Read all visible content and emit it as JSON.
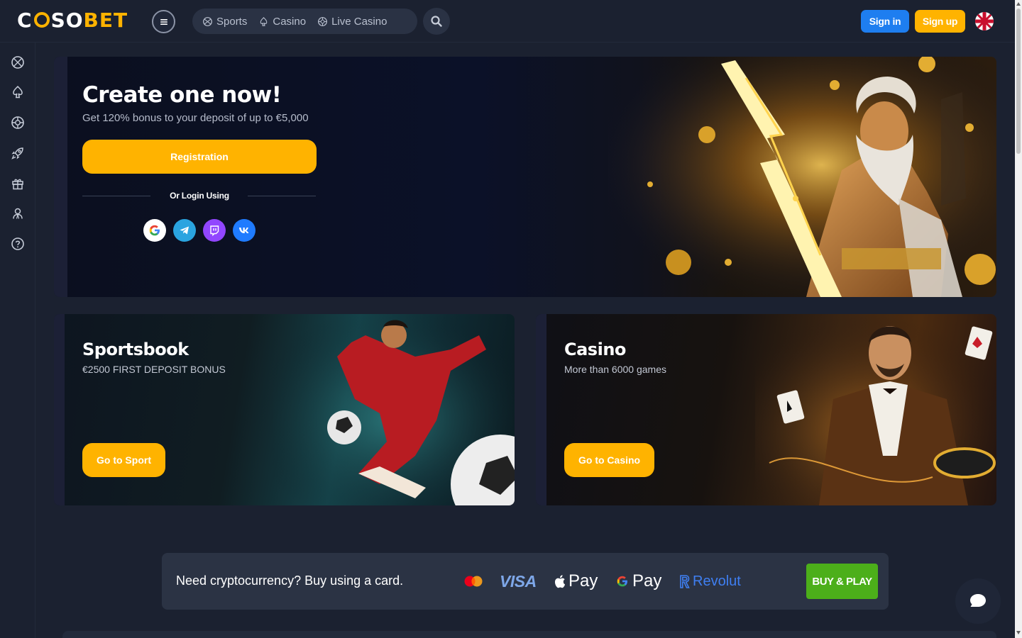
{
  "header": {
    "logo": {
      "part1": "C",
      "part2": "SO",
      "part3": "BET"
    },
    "nav": [
      {
        "label": "Sports",
        "icon": "soccer-ball-icon"
      },
      {
        "label": "Casino",
        "icon": "spade-icon"
      },
      {
        "label": "Live Casino",
        "icon": "roulette-icon"
      }
    ],
    "sign_in": "Sign in",
    "sign_up": "Sign up",
    "language": "uk-flag-icon"
  },
  "sidebar": {
    "items": [
      {
        "icon": "sports-ball-icon"
      },
      {
        "icon": "casino-spade-icon"
      },
      {
        "icon": "live-casino-icon"
      },
      {
        "icon": "crash-rocket-icon"
      },
      {
        "icon": "promotions-gift-icon"
      },
      {
        "icon": "vip-user-icon"
      },
      {
        "icon": "help-question-icon"
      }
    ]
  },
  "hero": {
    "title": "Create one now!",
    "subtitle": "Get 120% bonus to your deposit of up to €5,000",
    "registration_button": "Registration",
    "login_divider": "Or Login Using",
    "social": [
      "google-icon",
      "telegram-icon",
      "twitch-icon",
      "vk-icon"
    ]
  },
  "cards": {
    "sportsbook": {
      "title": "Sportsbook",
      "subtitle": "€2500 FIRST DEPOSIT BONUS",
      "button": "Go to Sport"
    },
    "casino": {
      "title": "Casino",
      "subtitle": "More than 6000 games",
      "button": "Go to Casino"
    }
  },
  "crypto_banner": {
    "text": "Need cryptocurrency? Buy using a card.",
    "payment_methods": {
      "mastercard": "mastercard-icon",
      "visa": "VISA",
      "apple_pay": "Pay",
      "google_pay": "Pay",
      "revolut": "Revolut"
    },
    "button": "BUY & PLAY"
  },
  "colors": {
    "accent": "#ffb300",
    "sign_in": "#1e7ef0",
    "buy_button": "#4caf1a",
    "background": "#1b2130"
  }
}
